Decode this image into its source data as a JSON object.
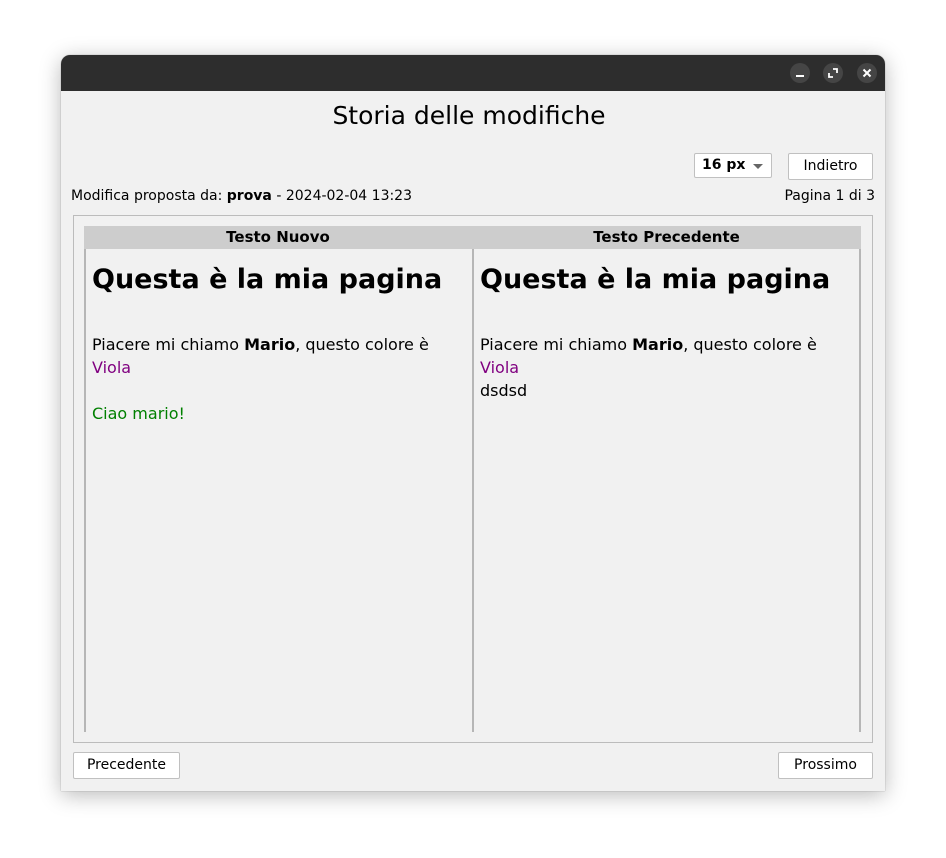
{
  "window": {
    "title": "Storia delle modifiche",
    "controls": [
      "minimize-icon",
      "maximize-icon",
      "close-icon"
    ]
  },
  "toolbar": {
    "font_size_value": "16 px",
    "back_label": "Indietro"
  },
  "info": {
    "prefix": "Modifica proposta da: ",
    "author": "prova",
    "separator": " - ",
    "date": "2024-02-04 13:23",
    "page": "Pagina 1 di 3"
  },
  "columns": {
    "new_header": "Testo Nuovo",
    "old_header": "Testo Precedente"
  },
  "new_text": {
    "heading": "Questa è la mia pagina",
    "line_start": "Piacere mi chiamo ",
    "name": "Mario",
    "line_mid": ", questo colore è ",
    "color_word": "Viola",
    "added_line": "Ciao mario!"
  },
  "old_text": {
    "heading": "Questa è la mia pagina",
    "line_start": "Piacere mi chiamo ",
    "name": "Mario",
    "line_mid": ", questo colore è ",
    "color_word": "Viola",
    "extra_line": "dsdsd"
  },
  "footer": {
    "prev_label": "Precedente",
    "next_label": "Prossimo"
  },
  "colors": {
    "viola_text": "#800080",
    "added_text": "#008000",
    "titlebar": "#2d2d2d"
  }
}
